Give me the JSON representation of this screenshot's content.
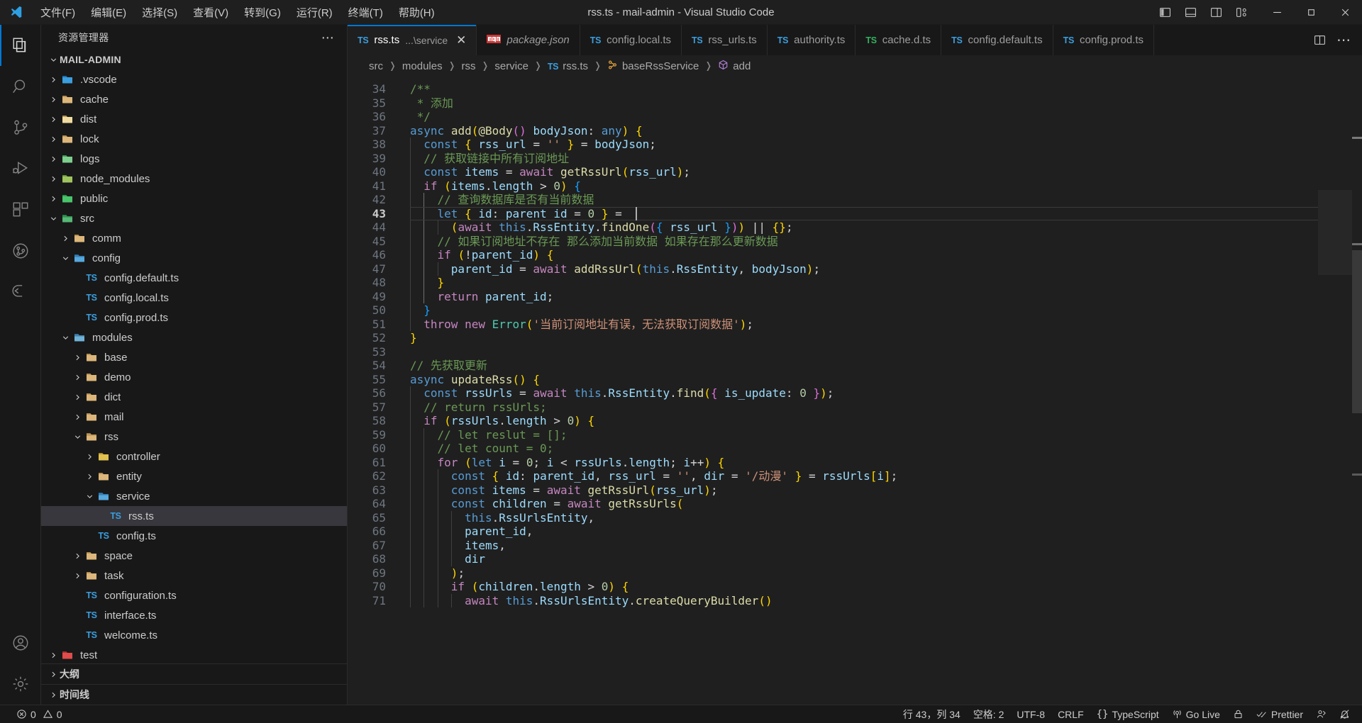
{
  "window": {
    "title": "rss.ts - mail-admin - Visual Studio Code",
    "logo_icon": "vscode-logo-icon",
    "menus": [
      {
        "label": "文件(F)",
        "name": "menu-file"
      },
      {
        "label": "编辑(E)",
        "name": "menu-edit"
      },
      {
        "label": "选择(S)",
        "name": "menu-selection"
      },
      {
        "label": "查看(V)",
        "name": "menu-view"
      },
      {
        "label": "转到(G)",
        "name": "menu-go"
      },
      {
        "label": "运行(R)",
        "name": "menu-run"
      },
      {
        "label": "终端(T)",
        "name": "menu-terminal"
      },
      {
        "label": "帮助(H)",
        "name": "menu-help"
      }
    ],
    "layout_buttons": [
      {
        "name": "toggle-primary-sidebar-icon"
      },
      {
        "name": "toggle-panel-icon"
      },
      {
        "name": "toggle-secondary-sidebar-icon"
      },
      {
        "name": "customize-layout-icon"
      }
    ],
    "window_controls": [
      {
        "name": "minimize-button"
      },
      {
        "name": "maximize-button"
      },
      {
        "name": "close-button"
      }
    ]
  },
  "activitybar": {
    "items": [
      {
        "name": "activity-explorer",
        "icon": "files-icon",
        "active": true
      },
      {
        "name": "activity-search",
        "icon": "search-icon",
        "active": false
      },
      {
        "name": "activity-source-control",
        "icon": "source-control-icon",
        "active": false
      },
      {
        "name": "activity-run-debug",
        "icon": "run-debug-icon",
        "active": false
      },
      {
        "name": "activity-extensions",
        "icon": "extensions-icon",
        "active": false
      },
      {
        "name": "activity-gitlens",
        "icon": "gitlens-icon",
        "active": false
      },
      {
        "name": "activity-remote",
        "icon": "remote-explorer-icon",
        "active": false
      }
    ],
    "bottom_items": [
      {
        "name": "activity-accounts",
        "icon": "account-icon"
      },
      {
        "name": "activity-settings",
        "icon": "gear-icon"
      }
    ]
  },
  "sidebar": {
    "header_title": "资源管理器",
    "more_actions_icon": "ellipsis-icon",
    "root_label": "MAIL-ADMIN",
    "tree": [
      {
        "label": ".vscode",
        "depth": 1,
        "type": "folder",
        "icon": "folder-vscode-icon",
        "expanded": false
      },
      {
        "label": "cache",
        "depth": 1,
        "type": "folder",
        "icon": "folder-icon",
        "expanded": false
      },
      {
        "label": "dist",
        "depth": 1,
        "type": "folder",
        "icon": "folder-dist-icon",
        "expanded": false
      },
      {
        "label": "lock",
        "depth": 1,
        "type": "folder",
        "icon": "folder-icon",
        "expanded": false
      },
      {
        "label": "logs",
        "depth": 1,
        "type": "folder",
        "icon": "folder-log-icon",
        "expanded": false
      },
      {
        "label": "node_modules",
        "depth": 1,
        "type": "folder",
        "icon": "folder-node-icon",
        "expanded": false
      },
      {
        "label": "public",
        "depth": 1,
        "type": "folder",
        "icon": "folder-public-icon",
        "expanded": false
      },
      {
        "label": "src",
        "depth": 1,
        "type": "folder",
        "icon": "folder-src-icon",
        "expanded": true
      },
      {
        "label": "comm",
        "depth": 2,
        "type": "folder",
        "icon": "folder-icon",
        "expanded": false
      },
      {
        "label": "config",
        "depth": 2,
        "type": "folder",
        "icon": "folder-config-icon",
        "expanded": true
      },
      {
        "label": "config.default.ts",
        "depth": 3,
        "type": "ts",
        "icon": "typescript-icon"
      },
      {
        "label": "config.local.ts",
        "depth": 3,
        "type": "ts",
        "icon": "typescript-icon"
      },
      {
        "label": "config.prod.ts",
        "depth": 3,
        "type": "ts",
        "icon": "typescript-icon"
      },
      {
        "label": "modules",
        "depth": 2,
        "type": "folder",
        "icon": "folder-modules-icon",
        "expanded": true
      },
      {
        "label": "base",
        "depth": 3,
        "type": "folder",
        "icon": "folder-icon",
        "expanded": false
      },
      {
        "label": "demo",
        "depth": 3,
        "type": "folder",
        "icon": "folder-icon",
        "expanded": false
      },
      {
        "label": "dict",
        "depth": 3,
        "type": "folder",
        "icon": "folder-icon",
        "expanded": false
      },
      {
        "label": "mail",
        "depth": 3,
        "type": "folder",
        "icon": "folder-icon",
        "expanded": false
      },
      {
        "label": "rss",
        "depth": 3,
        "type": "folder",
        "icon": "folder-icon",
        "expanded": true
      },
      {
        "label": "controller",
        "depth": 4,
        "type": "folder",
        "icon": "folder-controller-icon",
        "expanded": false
      },
      {
        "label": "entity",
        "depth": 4,
        "type": "folder",
        "icon": "folder-icon",
        "expanded": false
      },
      {
        "label": "service",
        "depth": 4,
        "type": "folder",
        "icon": "folder-service-icon",
        "expanded": true
      },
      {
        "label": "rss.ts",
        "depth": 5,
        "type": "ts",
        "icon": "typescript-icon",
        "selected": true
      },
      {
        "label": "config.ts",
        "depth": 4,
        "type": "ts",
        "icon": "typescript-icon"
      },
      {
        "label": "space",
        "depth": 3,
        "type": "folder",
        "icon": "folder-icon",
        "expanded": false
      },
      {
        "label": "task",
        "depth": 3,
        "type": "folder",
        "icon": "folder-icon",
        "expanded": false
      },
      {
        "label": "configuration.ts",
        "depth": 3,
        "type": "ts",
        "icon": "typescript-icon"
      },
      {
        "label": "interface.ts",
        "depth": 3,
        "type": "ts",
        "icon": "typescript-icon"
      },
      {
        "label": "welcome.ts",
        "depth": 3,
        "type": "ts",
        "icon": "typescript-icon"
      },
      {
        "label": "test",
        "depth": 1,
        "type": "folder",
        "icon": "folder-test-icon",
        "expanded": false
      }
    ],
    "bottom_sections": [
      {
        "label": "大纲",
        "name": "sidebar-section-outline"
      },
      {
        "label": "时间线",
        "name": "sidebar-section-timeline"
      }
    ]
  },
  "tabs": {
    "items": [
      {
        "name": "rss.ts",
        "sub": "...\\service",
        "icon": "typescript-icon",
        "icon_color": "blue",
        "active": true,
        "italic": false,
        "closable": true
      },
      {
        "name": "package.json",
        "sub": "",
        "icon": "npm-icon",
        "icon_color": "red",
        "active": false,
        "italic": true,
        "closable": false
      },
      {
        "name": "config.local.ts",
        "sub": "",
        "icon": "typescript-icon",
        "icon_color": "blue",
        "active": false,
        "italic": false,
        "closable": false
      },
      {
        "name": "rss_urls.ts",
        "sub": "",
        "icon": "typescript-icon",
        "icon_color": "blue",
        "active": false,
        "italic": false,
        "closable": false
      },
      {
        "name": "authority.ts",
        "sub": "",
        "icon": "typescript-icon",
        "icon_color": "blue",
        "active": false,
        "italic": false,
        "closable": false
      },
      {
        "name": "cache.d.ts",
        "sub": "",
        "icon": "typescript-def-icon",
        "icon_color": "green",
        "active": false,
        "italic": false,
        "closable": false
      },
      {
        "name": "config.default.ts",
        "sub": "",
        "icon": "typescript-icon",
        "icon_color": "blue",
        "active": false,
        "italic": false,
        "closable": false
      },
      {
        "name": "config.prod.ts",
        "sub": "",
        "icon": "typescript-icon",
        "icon_color": "blue",
        "active": false,
        "italic": false,
        "closable": false
      }
    ],
    "actions": [
      {
        "name": "split-editor-right-button",
        "icon": "split-editor-icon"
      },
      {
        "name": "more-editor-actions-button",
        "icon": "ellipsis-icon"
      }
    ]
  },
  "breadcrumbs": {
    "items": [
      {
        "label": "src",
        "icon": ""
      },
      {
        "label": "modules",
        "icon": ""
      },
      {
        "label": "rss",
        "icon": ""
      },
      {
        "label": "service",
        "icon": ""
      },
      {
        "label": "rss.ts",
        "icon": "typescript-icon"
      },
      {
        "label": "baseRssService",
        "icon": "symbol-class-icon"
      },
      {
        "label": "add",
        "icon": "symbol-method-icon"
      }
    ]
  },
  "editor": {
    "first_line": 34,
    "cursor_line": 43,
    "code_lines": [
      {
        "n": 34,
        "indent": 0,
        "html": "<span class=\"cm\">/**</span>"
      },
      {
        "n": 35,
        "indent": 0,
        "html": "<span class=\"cm\"> * 添加</span>"
      },
      {
        "n": 36,
        "indent": 0,
        "html": "<span class=\"cm\"> */</span>"
      },
      {
        "n": 37,
        "indent": 0,
        "html": "<span class=\"k\">async</span> <span class=\"fn\">add</span><span class=\"p1\">(</span><span class=\"dec\">@Body</span><span class=\"p2\">()</span> <span class=\"var\">bodyJson</span><span class=\"op\">:</span> <span class=\"k\">any</span><span class=\"p1\">)</span> <span class=\"p1\">{</span>"
      },
      {
        "n": 38,
        "indent": 1,
        "html": "  <span class=\"k\">const</span> <span class=\"p1\">{</span> <span class=\"var\">rss_url</span> <span class=\"op\">=</span> <span class=\"str\">''</span> <span class=\"p1\">}</span> <span class=\"op\">=</span> <span class=\"var\">bodyJson</span><span class=\"op\">;</span>"
      },
      {
        "n": 39,
        "indent": 1,
        "html": "  <span class=\"cm\">// 获取链接中所有订阅地址</span>"
      },
      {
        "n": 40,
        "indent": 1,
        "html": "  <span class=\"k\">const</span> <span class=\"var\">items</span> <span class=\"op\">=</span> <span class=\"kp\">await</span> <span class=\"fn\">getRssUrl</span><span class=\"p1\">(</span><span class=\"var\">rss_url</span><span class=\"p1\">)</span><span class=\"op\">;</span>"
      },
      {
        "n": 41,
        "indent": 1,
        "html": "  <span class=\"kp\">if</span> <span class=\"p1\">(</span><span class=\"var\">items</span><span class=\"op\">.</span><span class=\"var\">length</span> <span class=\"op\">&gt;</span> <span class=\"num\">0</span><span class=\"p1\">)</span> <span class=\"p3\">{</span>"
      },
      {
        "n": 42,
        "indent": 2,
        "html": "    <span class=\"cm\">// 查询数据库是否有当前数据</span>"
      },
      {
        "n": 43,
        "indent": 2,
        "html": "    <span class=\"k\">let</span> <span class=\"p1\">{</span> <span class=\"var\">id</span><span class=\"op\">:</span> <span class=\"var\">parent_id</span> <span class=\"op\">=</span> <span class=\"num\">0</span> <span class=\"p1\">}</span> <span class=\"op\">=</span>"
      },
      {
        "n": 44,
        "indent": 3,
        "html": "      <span class=\"p1\">(</span><span class=\"kp\">await</span> <span class=\"k\">this</span><span class=\"op\">.</span><span class=\"var\">RssEntity</span><span class=\"op\">.</span><span class=\"fn\">findOne</span><span class=\"p2\">(</span><span class=\"p3\">{</span> <span class=\"var\">rss_url</span> <span class=\"p3\">}</span><span class=\"p2\">)</span><span class=\"p1\">)</span> <span class=\"op\">||</span> <span class=\"p1\">{}</span><span class=\"op\">;</span>"
      },
      {
        "n": 45,
        "indent": 2,
        "html": "    <span class=\"cm\">// 如果订阅地址不存在 那么添加当前数据 如果存在那么更新数据</span>"
      },
      {
        "n": 46,
        "indent": 2,
        "html": "    <span class=\"kp\">if</span> <span class=\"p1\">(</span><span class=\"op\">!</span><span class=\"var\">parent_id</span><span class=\"p1\">)</span> <span class=\"p1\">{</span>"
      },
      {
        "n": 47,
        "indent": 3,
        "html": "      <span class=\"var\">parent_id</span> <span class=\"op\">=</span> <span class=\"kp\">await</span> <span class=\"fn\">addRssUrl</span><span class=\"p1\">(</span><span class=\"k\">this</span><span class=\"op\">.</span><span class=\"var\">RssEntity</span><span class=\"op\">,</span> <span class=\"var\">bodyJson</span><span class=\"p1\">)</span><span class=\"op\">;</span>"
      },
      {
        "n": 48,
        "indent": 2,
        "html": "    <span class=\"p1\">}</span>"
      },
      {
        "n": 49,
        "indent": 2,
        "html": "    <span class=\"kp\">return</span> <span class=\"var\">parent_id</span><span class=\"op\">;</span>"
      },
      {
        "n": 50,
        "indent": 1,
        "html": "  <span class=\"p3\">}</span>"
      },
      {
        "n": 51,
        "indent": 1,
        "html": "  <span class=\"kp\">throw</span> <span class=\"kp\">new</span> <span class=\"ty\">Error</span><span class=\"p1\">(</span><span class=\"str\">'当前订阅地址有误，无法获取订阅数据'</span><span class=\"p1\">)</span><span class=\"op\">;</span>"
      },
      {
        "n": 52,
        "indent": 0,
        "html": "<span class=\"p1\">}</span>"
      },
      {
        "n": 53,
        "indent": 0,
        "html": ""
      },
      {
        "n": 54,
        "indent": 0,
        "html": "<span class=\"cm\">// 先获取更新</span>"
      },
      {
        "n": 55,
        "indent": 0,
        "html": "<span class=\"k\">async</span> <span class=\"fn\">updateRss</span><span class=\"p1\">()</span> <span class=\"p1\">{</span>"
      },
      {
        "n": 56,
        "indent": 1,
        "html": "  <span class=\"k\">const</span> <span class=\"var\">rssUrls</span> <span class=\"op\">=</span> <span class=\"kp\">await</span> <span class=\"k\">this</span><span class=\"op\">.</span><span class=\"var\">RssEntity</span><span class=\"op\">.</span><span class=\"fn\">find</span><span class=\"p1\">(</span><span class=\"p2\">{</span> <span class=\"var\">is_update</span><span class=\"op\">:</span> <span class=\"num\">0</span> <span class=\"p2\">}</span><span class=\"p1\">)</span><span class=\"op\">;</span>"
      },
      {
        "n": 57,
        "indent": 1,
        "html": "  <span class=\"cm\">// return rssUrls;</span>"
      },
      {
        "n": 58,
        "indent": 1,
        "html": "  <span class=\"kp\">if</span> <span class=\"p1\">(</span><span class=\"var\">rssUrls</span><span class=\"op\">.</span><span class=\"var\">length</span> <span class=\"op\">&gt;</span> <span class=\"num\">0</span><span class=\"p1\">)</span> <span class=\"p1\">{</span>"
      },
      {
        "n": 59,
        "indent": 2,
        "html": "    <span class=\"cm\">// let reslut = [];</span>"
      },
      {
        "n": 60,
        "indent": 2,
        "html": "    <span class=\"cm\">// let count = 0;</span>"
      },
      {
        "n": 61,
        "indent": 2,
        "html": "    <span class=\"kp\">for</span> <span class=\"p1\">(</span><span class=\"k\">let</span> <span class=\"var\">i</span> <span class=\"op\">=</span> <span class=\"num\">0</span><span class=\"op\">;</span> <span class=\"var\">i</span> <span class=\"op\">&lt;</span> <span class=\"var\">rssUrls</span><span class=\"op\">.</span><span class=\"var\">length</span><span class=\"op\">;</span> <span class=\"var\">i</span><span class=\"op\">++</span><span class=\"p1\">)</span> <span class=\"p1\">{</span>"
      },
      {
        "n": 62,
        "indent": 3,
        "html": "      <span class=\"k\">const</span> <span class=\"p1\">{</span> <span class=\"var\">id</span><span class=\"op\">:</span> <span class=\"var\">parent_id</span><span class=\"op\">,</span> <span class=\"var\">rss_url</span> <span class=\"op\">=</span> <span class=\"str\">''</span><span class=\"op\">,</span> <span class=\"var\">dir</span> <span class=\"op\">=</span> <span class=\"str\">'/动漫'</span> <span class=\"p1\">}</span> <span class=\"op\">=</span> <span class=\"var\">rssUrls</span><span class=\"p1\">[</span><span class=\"var\">i</span><span class=\"p1\">]</span><span class=\"op\">;</span>"
      },
      {
        "n": 63,
        "indent": 3,
        "html": "      <span class=\"k\">const</span> <span class=\"var\">items</span> <span class=\"op\">=</span> <span class=\"kp\">await</span> <span class=\"fn\">getRssUrl</span><span class=\"p1\">(</span><span class=\"var\">rss_url</span><span class=\"p1\">)</span><span class=\"op\">;</span>"
      },
      {
        "n": 64,
        "indent": 3,
        "html": "      <span class=\"k\">const</span> <span class=\"var\">children</span> <span class=\"op\">=</span> <span class=\"kp\">await</span> <span class=\"fn\">getRssUrls</span><span class=\"p1\">(</span>"
      },
      {
        "n": 65,
        "indent": 4,
        "html": "        <span class=\"k\">this</span><span class=\"op\">.</span><span class=\"var\">RssUrlsEntity</span><span class=\"op\">,</span>"
      },
      {
        "n": 66,
        "indent": 4,
        "html": "        <span class=\"var\">parent_id</span><span class=\"op\">,</span>"
      },
      {
        "n": 67,
        "indent": 4,
        "html": "        <span class=\"var\">items</span><span class=\"op\">,</span>"
      },
      {
        "n": 68,
        "indent": 4,
        "html": "        <span class=\"var\">dir</span>"
      },
      {
        "n": 69,
        "indent": 3,
        "html": "      <span class=\"p1\">)</span><span class=\"op\">;</span>"
      },
      {
        "n": 70,
        "indent": 3,
        "html": "      <span class=\"kp\">if</span> <span class=\"p1\">(</span><span class=\"var\">children</span><span class=\"op\">.</span><span class=\"var\">length</span> <span class=\"op\">&gt;</span> <span class=\"num\">0</span><span class=\"p1\">)</span> <span class=\"p1\">{</span>"
      },
      {
        "n": 71,
        "indent": 4,
        "html": "        <span class=\"kp\">await</span> <span class=\"k\">this</span><span class=\"op\">.</span><span class=\"var\">RssUrlsEntity</span><span class=\"op\">.</span><span class=\"fn\">createQueryBuilder</span><span class=\"p1\">()</span>"
      }
    ]
  },
  "statusbar": {
    "left": [
      {
        "name": "status-problems",
        "icon": "error-warning-icon",
        "label": "0  0",
        "errors": "0",
        "warnings": "0"
      }
    ],
    "right": [
      {
        "name": "status-cursor-position",
        "label": "行 43，列 34"
      },
      {
        "name": "status-indentation",
        "label": "空格: 2"
      },
      {
        "name": "status-encoding",
        "label": "UTF-8"
      },
      {
        "name": "status-eol",
        "label": "CRLF"
      },
      {
        "name": "status-language-mode",
        "label": "TypeScript",
        "icon": "braces-icon"
      },
      {
        "name": "status-go-live",
        "label": "Go Live",
        "icon": "broadcast-icon"
      },
      {
        "name": "status-tunnel",
        "label": "",
        "icon": "lock-icon"
      },
      {
        "name": "status-prettier",
        "label": "Prettier",
        "icon": "check-check-icon"
      },
      {
        "name": "status-live-share",
        "label": "",
        "icon": "live-share-icon"
      },
      {
        "name": "status-notifications",
        "label": "",
        "icon": "bell-dot-icon"
      }
    ]
  }
}
